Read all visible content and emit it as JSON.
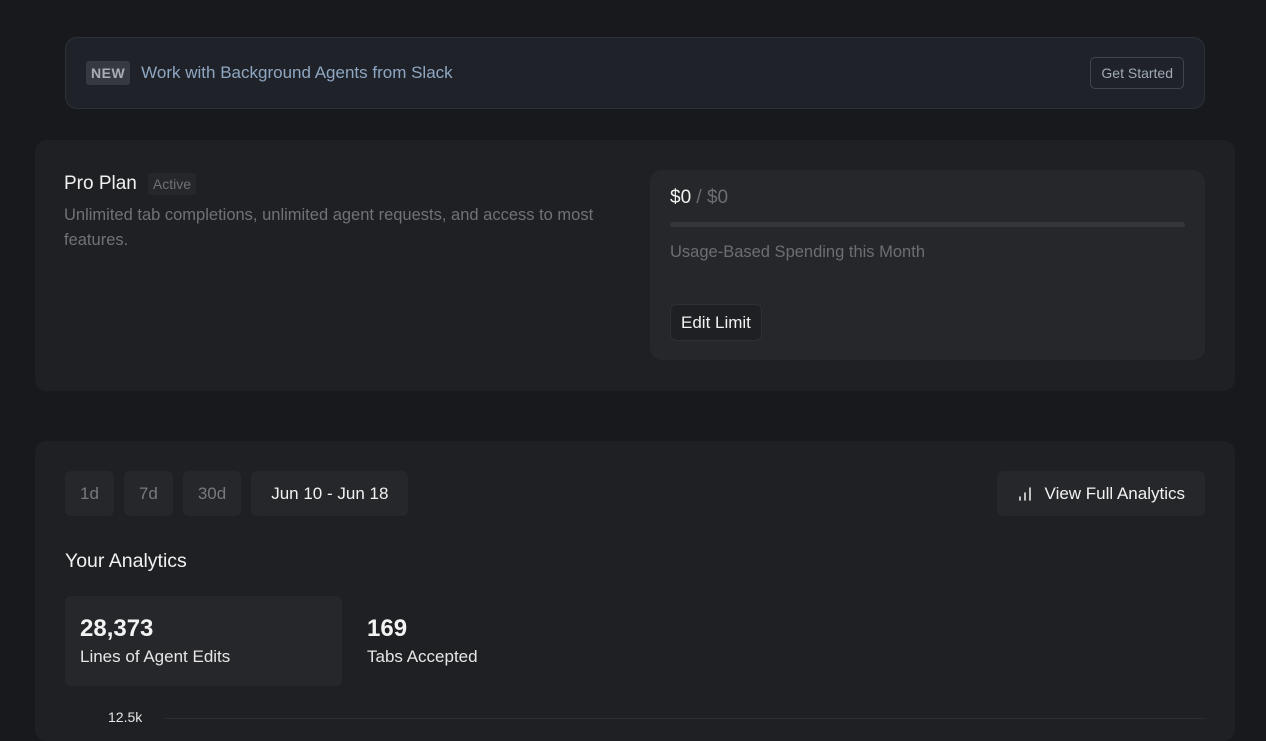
{
  "banner": {
    "badge": "NEW",
    "text": "Work with Background Agents from Slack",
    "cta": "Get Started"
  },
  "plan": {
    "name": "Pro Plan",
    "status": "Active",
    "description": "Unlimited tab completions, unlimited agent requests, and access to most features.",
    "usage": {
      "current": "$0",
      "separator": "/",
      "limit": "$0",
      "progress_fraction": 0,
      "label": "Usage-Based Spending this Month",
      "edit_button": "Edit Limit"
    }
  },
  "analytics": {
    "ranges": [
      "1d",
      "7d",
      "30d",
      "Jun 10 - Jun 18"
    ],
    "selected_range": "Jun 10 - Jun 18",
    "full_analytics_button": "View Full Analytics",
    "title": "Your Analytics",
    "stats": [
      {
        "value": "28,373",
        "label": "Lines of Agent Edits"
      },
      {
        "value": "169",
        "label": "Tabs Accepted"
      }
    ],
    "chart_tick_top": "12.5k"
  },
  "icons": {
    "analytics_icon": "bar-chart-icon"
  }
}
